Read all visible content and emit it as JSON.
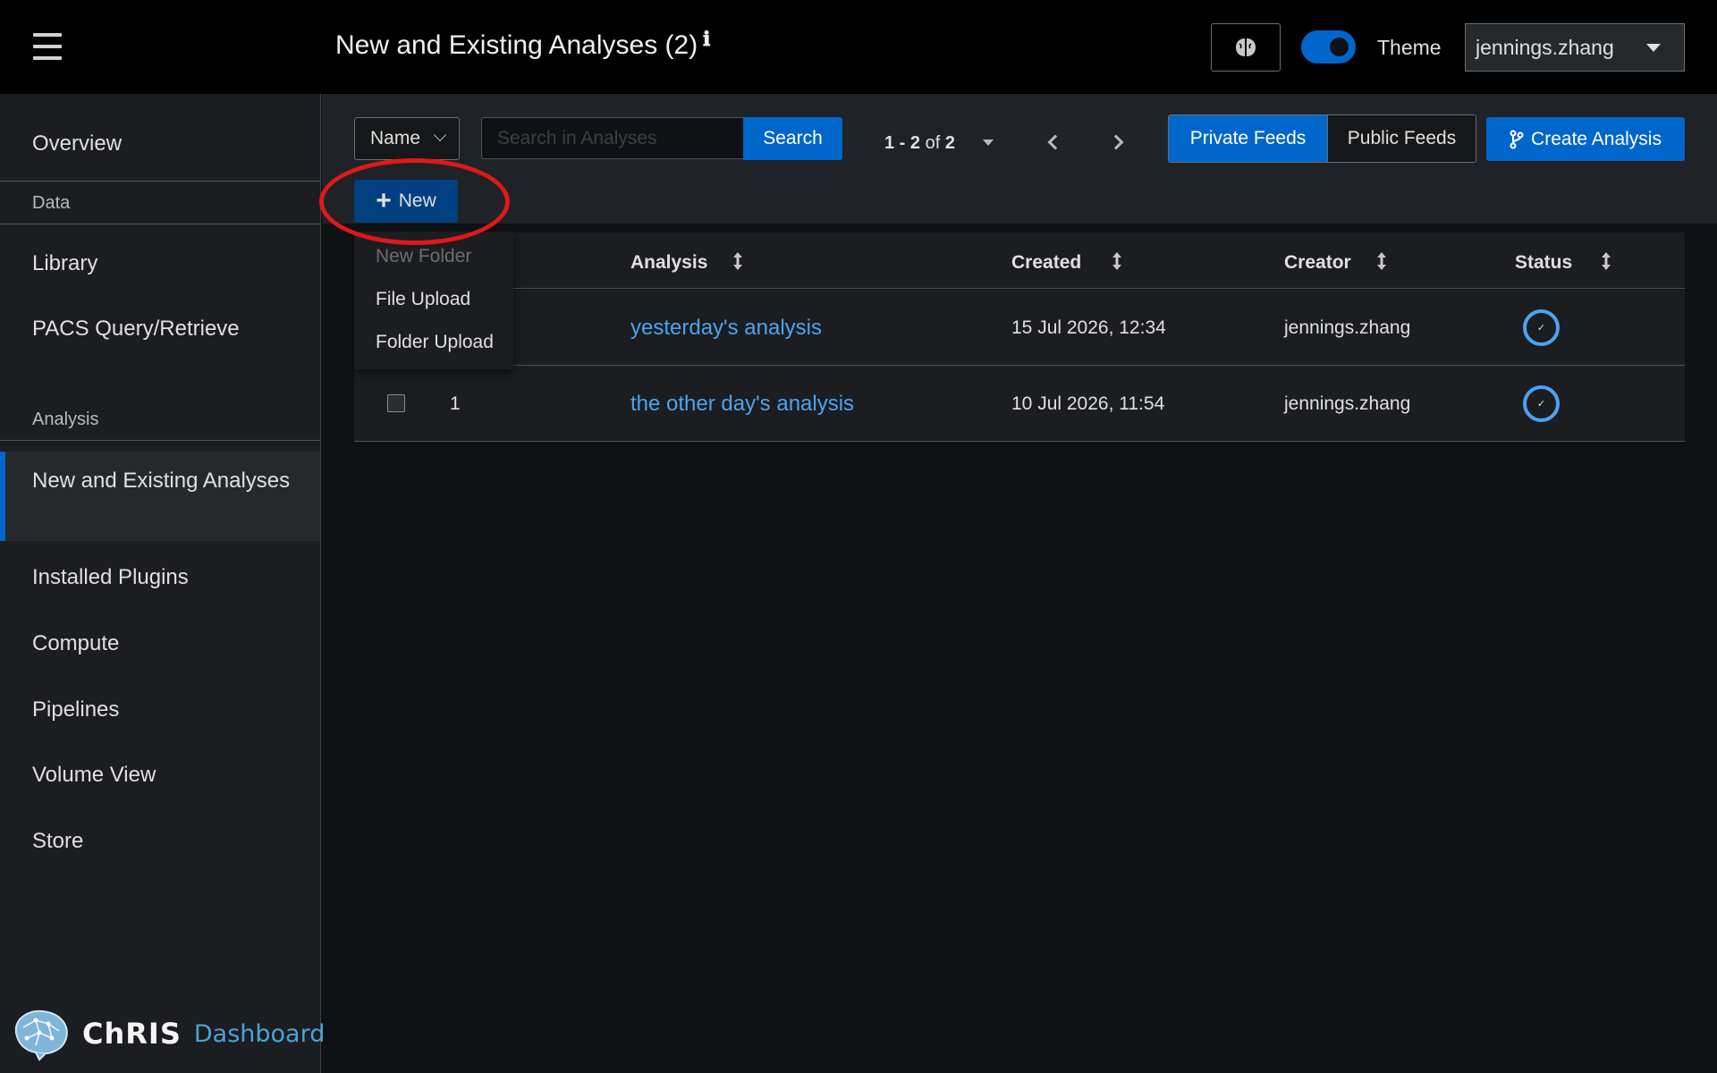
{
  "header": {
    "title": "New and Existing Analyses (2)",
    "info_icon": "ℹ",
    "theme_label": "Theme",
    "user": "jennings.zhang"
  },
  "sidebar": {
    "items": [
      {
        "label": "Overview"
      },
      {
        "group": "Data"
      },
      {
        "label": "Library"
      },
      {
        "label": "PACS Query/Retrieve"
      },
      {
        "group": "Analysis"
      },
      {
        "label": "New and Existing Analyses",
        "active": true
      },
      {
        "label": "Installed Plugins"
      },
      {
        "label": "Compute"
      },
      {
        "label": "Pipelines"
      },
      {
        "label": "Volume View"
      },
      {
        "label": "Store"
      }
    ],
    "logo_primary": "ChRIS",
    "logo_secondary": "Dashboard"
  },
  "toolbar": {
    "filter_select": "Name",
    "search_placeholder": "Search in Analyses",
    "search_button": "Search",
    "pagination": {
      "range_start": "1",
      "range_end": "2",
      "of_label": "of",
      "total": "2"
    },
    "private_feeds": "Private Feeds",
    "public_feeds": "Public Feeds",
    "create_analysis": "Create Analysis",
    "new_button": "New"
  },
  "new_menu": {
    "items": [
      {
        "label": "New Folder",
        "disabled": true
      },
      {
        "label": "File Upload",
        "disabled": false
      },
      {
        "label": "Folder Upload",
        "disabled": false
      }
    ]
  },
  "table": {
    "columns": [
      "Analysis",
      "Created",
      "Creator",
      "Status"
    ],
    "rows": [
      {
        "id": "",
        "analysis": "yesterday's analysis",
        "created": "15 Jul 2026, 12:34",
        "creator": "jennings.zhang",
        "status": "✓"
      },
      {
        "id": "1",
        "analysis": "the other day's analysis",
        "created": "10 Jul 2026, 11:54",
        "creator": "jennings.zhang",
        "status": "✓"
      }
    ]
  },
  "colors": {
    "accent": "#0066cc",
    "link": "#4ba3f0",
    "highlight_ring": "#e01818"
  }
}
